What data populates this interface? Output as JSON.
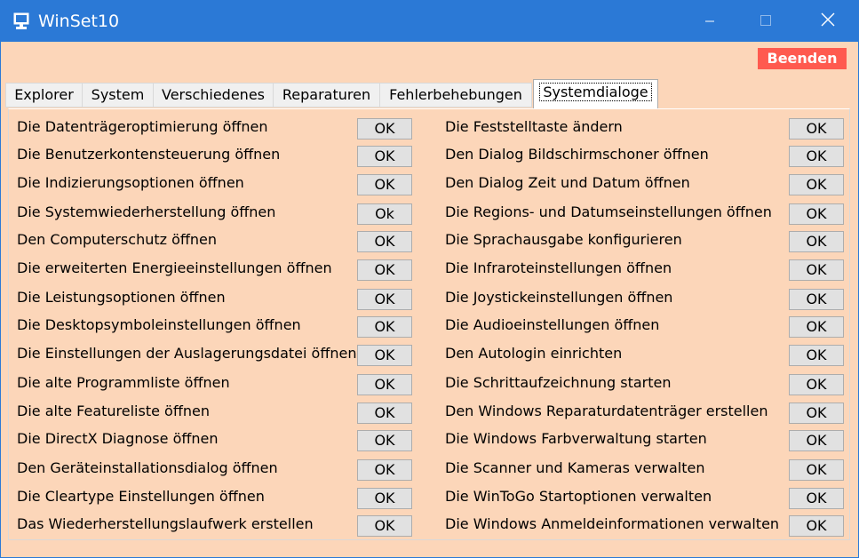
{
  "window": {
    "title": "WinSet10",
    "exit_label": "Beenden"
  },
  "tabs": [
    {
      "label": "Explorer",
      "active": false
    },
    {
      "label": "System",
      "active": false
    },
    {
      "label": "Verschiedenes",
      "active": false
    },
    {
      "label": "Reparaturen",
      "active": false
    },
    {
      "label": "Fehlerbehebungen",
      "active": false
    },
    {
      "label": "Systemdialoge",
      "active": true
    }
  ],
  "left_items": [
    {
      "label": "Die Datenträgeroptimierung öffnen",
      "button": "OK"
    },
    {
      "label": "Die Benutzerkontensteuerung öffnen",
      "button": "OK"
    },
    {
      "label": "Die Indizierungsoptionen öffnen",
      "button": "OK"
    },
    {
      "label": "Die Systemwiederherstellung öffnen",
      "button": "Ok"
    },
    {
      "label": "Den Computerschutz öffnen",
      "button": "OK"
    },
    {
      "label": "Die erweiterten Energieeinstellungen öffnen",
      "button": "OK"
    },
    {
      "label": "Die Leistungsoptionen öffnen",
      "button": "OK"
    },
    {
      "label": "Die Desktopsymboleinstellungen öffnen",
      "button": "OK"
    },
    {
      "label": "Die Einstellungen der Auslagerungsdatei öffnen",
      "button": "OK"
    },
    {
      "label": "Die alte Programmliste öffnen",
      "button": "OK"
    },
    {
      "label": "Die alte Featureliste öffnen",
      "button": "OK"
    },
    {
      "label": "Die DirectX Diagnose öffnen",
      "button": "OK"
    },
    {
      "label": "Den Geräteinstallationsdialog öffnen",
      "button": "OK"
    },
    {
      "label": "Die Cleartype Einstellungen öffnen",
      "button": "OK"
    },
    {
      "label": "Das Wiederherstellungslaufwerk erstellen",
      "button": "OK"
    }
  ],
  "right_items": [
    {
      "label": "Die Feststelltaste ändern",
      "button": "OK"
    },
    {
      "label": "Den Dialog Bildschirmschoner öffnen",
      "button": "OK"
    },
    {
      "label": "Den Dialog Zeit und Datum öffnen",
      "button": "OK"
    },
    {
      "label": "Die Regions- und Datumseinstellungen öffnen",
      "button": "OK"
    },
    {
      "label": "Die Sprachausgabe konfigurieren",
      "button": "OK"
    },
    {
      "label": "Die Infraroteinstellungen öffnen",
      "button": "OK"
    },
    {
      "label": "Die Joystickeinstellungen öffnen",
      "button": "OK"
    },
    {
      "label": "Die Audioeinstellungen öffnen",
      "button": "OK"
    },
    {
      "label": "Den Autologin einrichten",
      "button": "OK"
    },
    {
      "label": "Die Schrittaufzeichnung starten",
      "button": "OK"
    },
    {
      "label": "Den Windows Reparaturdatenträger erstellen",
      "button": "OK"
    },
    {
      "label": "Die Windows Farbverwaltung starten",
      "button": "OK"
    },
    {
      "label": "Die Scanner und Kameras verwalten",
      "button": "OK"
    },
    {
      "label": "Die WinToGo Startoptionen verwalten",
      "button": "OK"
    },
    {
      "label": "Die Windows Anmeldeinformationen verwalten",
      "button": "OK"
    }
  ],
  "colors": {
    "titlebar": "#2b79d6",
    "window_bg": "#fcd6b9",
    "exit_button": "#ff5a4f"
  },
  "icons": {
    "app": "computer-monitor-icon",
    "minimize": "minimize-icon",
    "maximize": "maximize-icon",
    "close": "close-icon"
  }
}
